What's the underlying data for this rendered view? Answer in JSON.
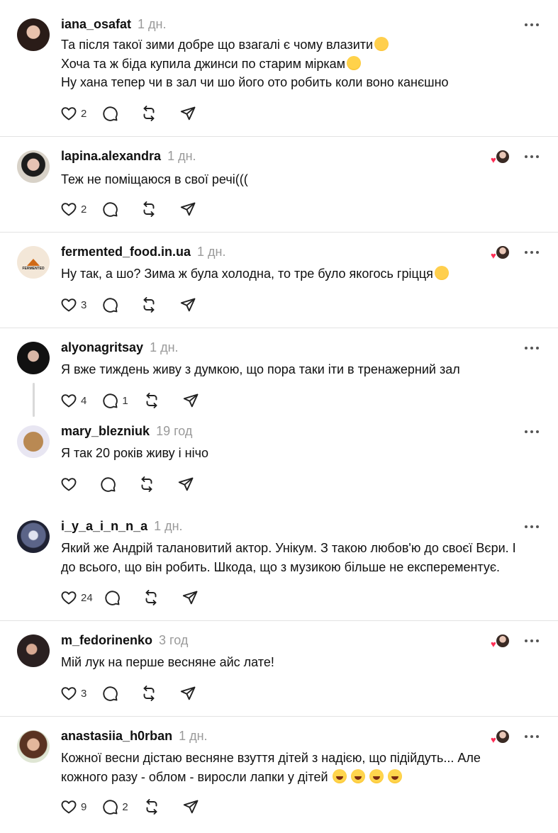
{
  "posts": [
    {
      "username": "iana_osafat",
      "time": "1 дн.",
      "lines": [
        "Та після такої зими добре що взагалі є чому влазити",
        "Хоча та ж біда купила джинси по старим міркам",
        "Ну хана тепер чи в зал чи шо його ото робить коли воно канєшно"
      ],
      "emojis": [
        "smile",
        "hug",
        ""
      ],
      "like_count": "2",
      "reply_count": "",
      "liked_by_author": false
    },
    {
      "username": "lapina.alexandra",
      "time": "1 дн.",
      "lines": [
        "Теж не поміщаюся в свої речі((("
      ],
      "like_count": "2",
      "reply_count": "",
      "liked_by_author": true
    },
    {
      "username": "fermented_food.in.ua",
      "time": "1 дн.",
      "lines": [
        "Ну так, а шо? Зима ж була холодна, то тре було якогось гріцця"
      ],
      "emojis": [
        "smile"
      ],
      "like_count": "3",
      "reply_count": "",
      "liked_by_author": true
    },
    {
      "username": "alyonagritsay",
      "time": "1 дн.",
      "lines": [
        "Я вже тиждень живу з думкою, що пора таки іти в тренажерний зал"
      ],
      "like_count": "4",
      "reply_count": "1",
      "liked_by_author": false
    },
    {
      "username": "mary_blezniuk",
      "time": "19 год",
      "lines": [
        "Я так 20 років живу і нічо"
      ],
      "like_count": "",
      "reply_count": "",
      "liked_by_author": false
    },
    {
      "username": "i_y_a_i_n_n_a",
      "time": "1 дн.",
      "lines": [
        "Який же Андрій талановитий актор. Унікум. З такою любов'ю до своєї Вєри. І",
        "до всього, що він робить. Шкода, що з музикою більше не експерементує."
      ],
      "like_count": "24",
      "reply_count": "",
      "liked_by_author": false
    },
    {
      "username": "m_fedorinenko",
      "time": "3 год",
      "lines": [
        "Мій лук на перше весняне айс лате!"
      ],
      "like_count": "3",
      "reply_count": "",
      "liked_by_author": true
    },
    {
      "username": "anastasiia_h0rban",
      "time": "1 дн.",
      "lines": [
        "Кожної весни дістаю весняне взуття дітей з надією, що підійдуть... Але",
        "кожного разу - облом - виросли лапки у дітей"
      ],
      "emojis": [
        "",
        "laugh4"
      ],
      "like_count": "9",
      "reply_count": "2",
      "liked_by_author": true
    }
  ],
  "fermented_logo_text": "FERMENTED",
  "colors": {
    "heart": "#ff2d55",
    "muted": "#9a9a9a",
    "divider": "#e3e3e3",
    "text": "#101010"
  },
  "icons": [
    "heart-icon",
    "comment-icon",
    "repost-icon",
    "share-icon",
    "more-icon"
  ]
}
